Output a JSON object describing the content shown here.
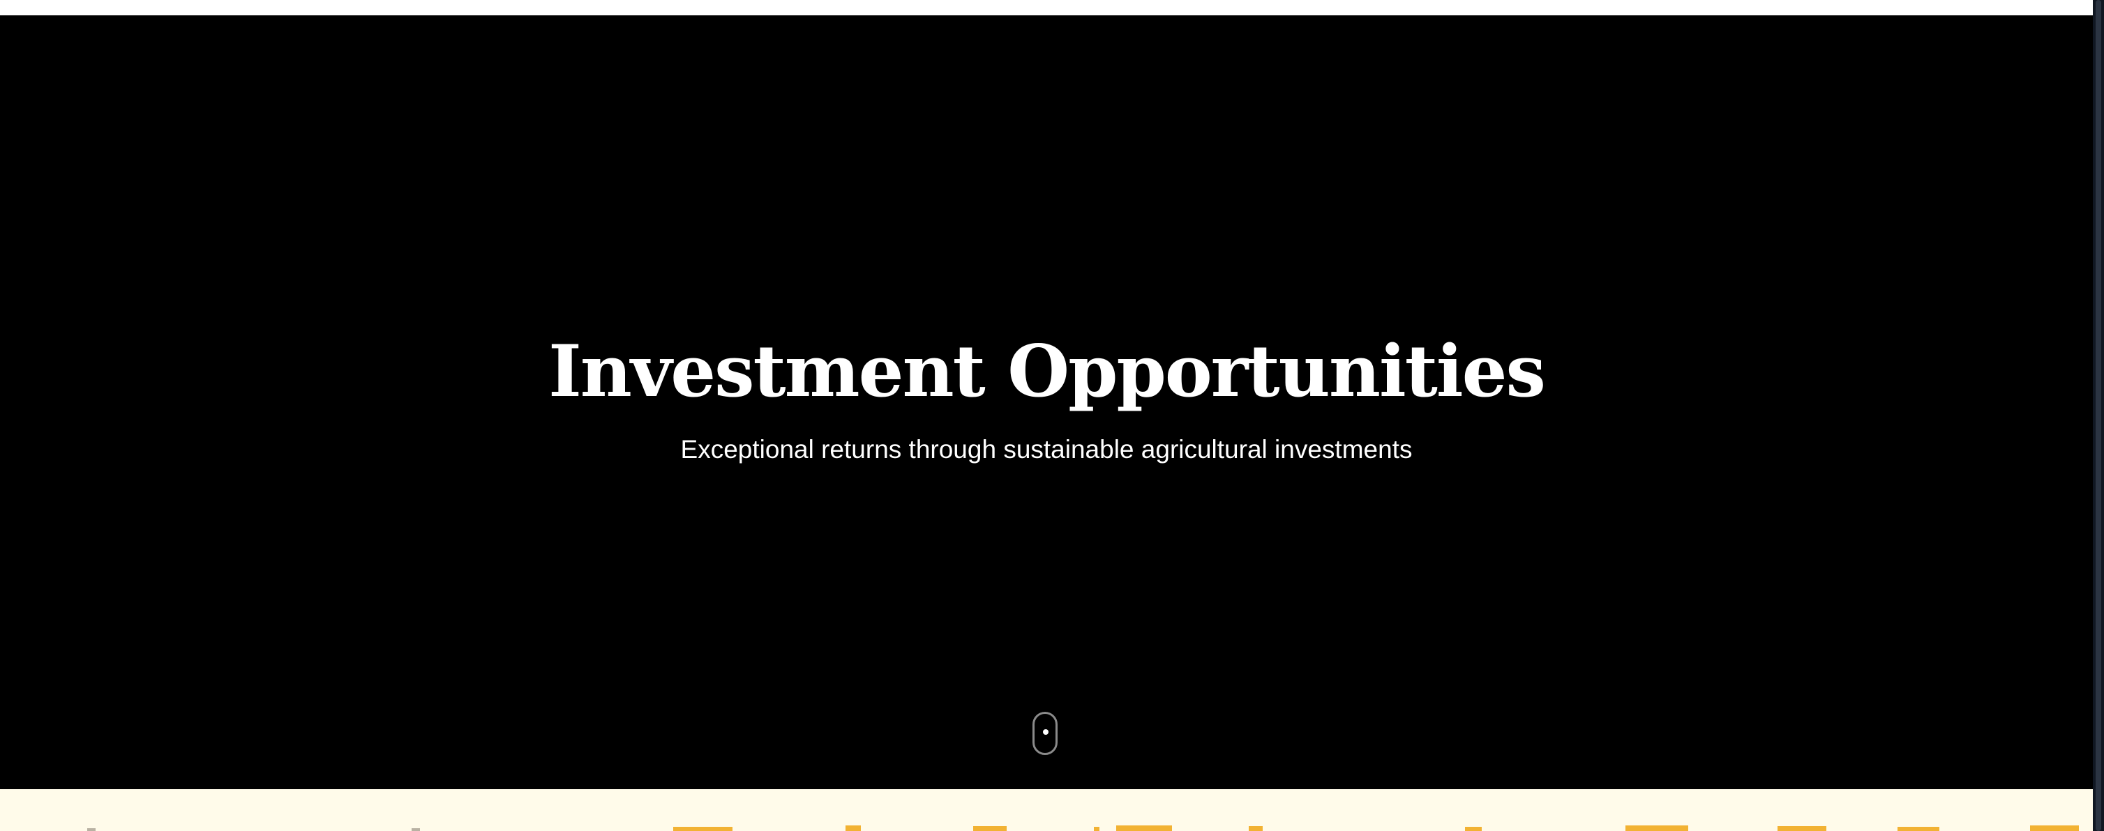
{
  "hero": {
    "title": "Investment Opportunities",
    "subtitle": "Exceptional returns through sustainable agricultural investments",
    "scroll_indicator_icon": "mouse-scroll-icon"
  },
  "colors": {
    "hero_background": "#000000",
    "hero_text": "#ffffff",
    "next_section_background": "#fffbea",
    "next_section_accent": "#f2b233",
    "scrollbar_track": "#101722"
  }
}
